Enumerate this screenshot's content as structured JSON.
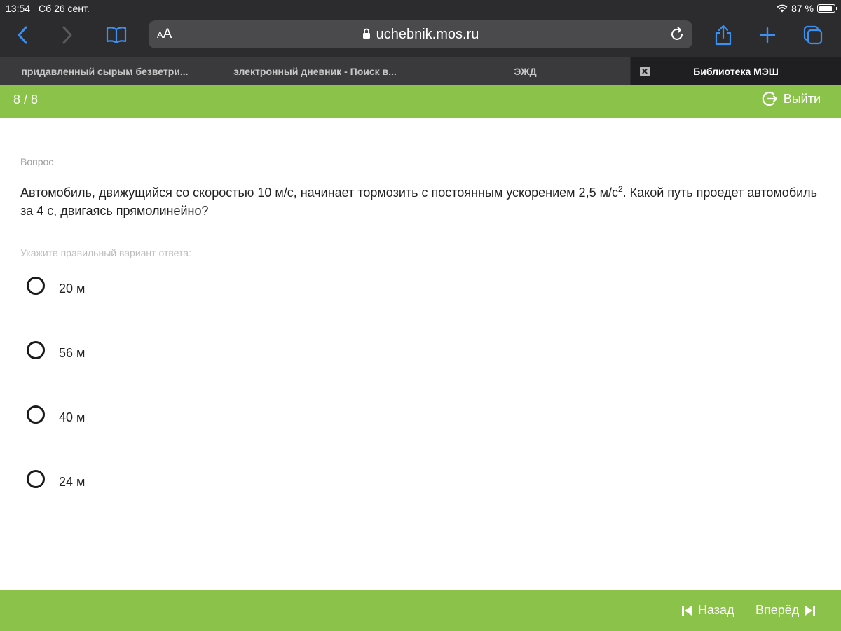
{
  "status_bar": {
    "time": "13:54",
    "date": "Сб 26 сент.",
    "battery": "87 %"
  },
  "browser": {
    "aa_label": "AA",
    "url": "uchebnik.mos.ru",
    "tabs": [
      {
        "title": "придавленный сырым безветри..."
      },
      {
        "title": "электронный дневник - Поиск в..."
      },
      {
        "title": "ЭЖД"
      },
      {
        "title": "Библиотека МЭШ",
        "active": true
      }
    ]
  },
  "quiz": {
    "counter": "8 / 8",
    "exit_label": "Выйти",
    "question_label": "Вопрос",
    "question_text_before": "Автомобиль, движущийся со скоростью 10 м/с, начинает тормозить с постоянным ускорением 2,5 м/с",
    "question_superscript": "2",
    "question_text_after": ". Какой путь проедет автомобиль за 4 с, двигаясь прямолинейно?",
    "hint": "Укажите правильный вариант ответа:",
    "options": [
      {
        "label": "20 м"
      },
      {
        "label": "56 м"
      },
      {
        "label": "40 м"
      },
      {
        "label": "24 м"
      }
    ],
    "back_label": "Назад",
    "forward_label": "Вперёд"
  },
  "colors": {
    "accent_green": "#8bc34a",
    "browser_chrome": "#2c2c2e",
    "ios_blue": "#3d8ff0"
  }
}
